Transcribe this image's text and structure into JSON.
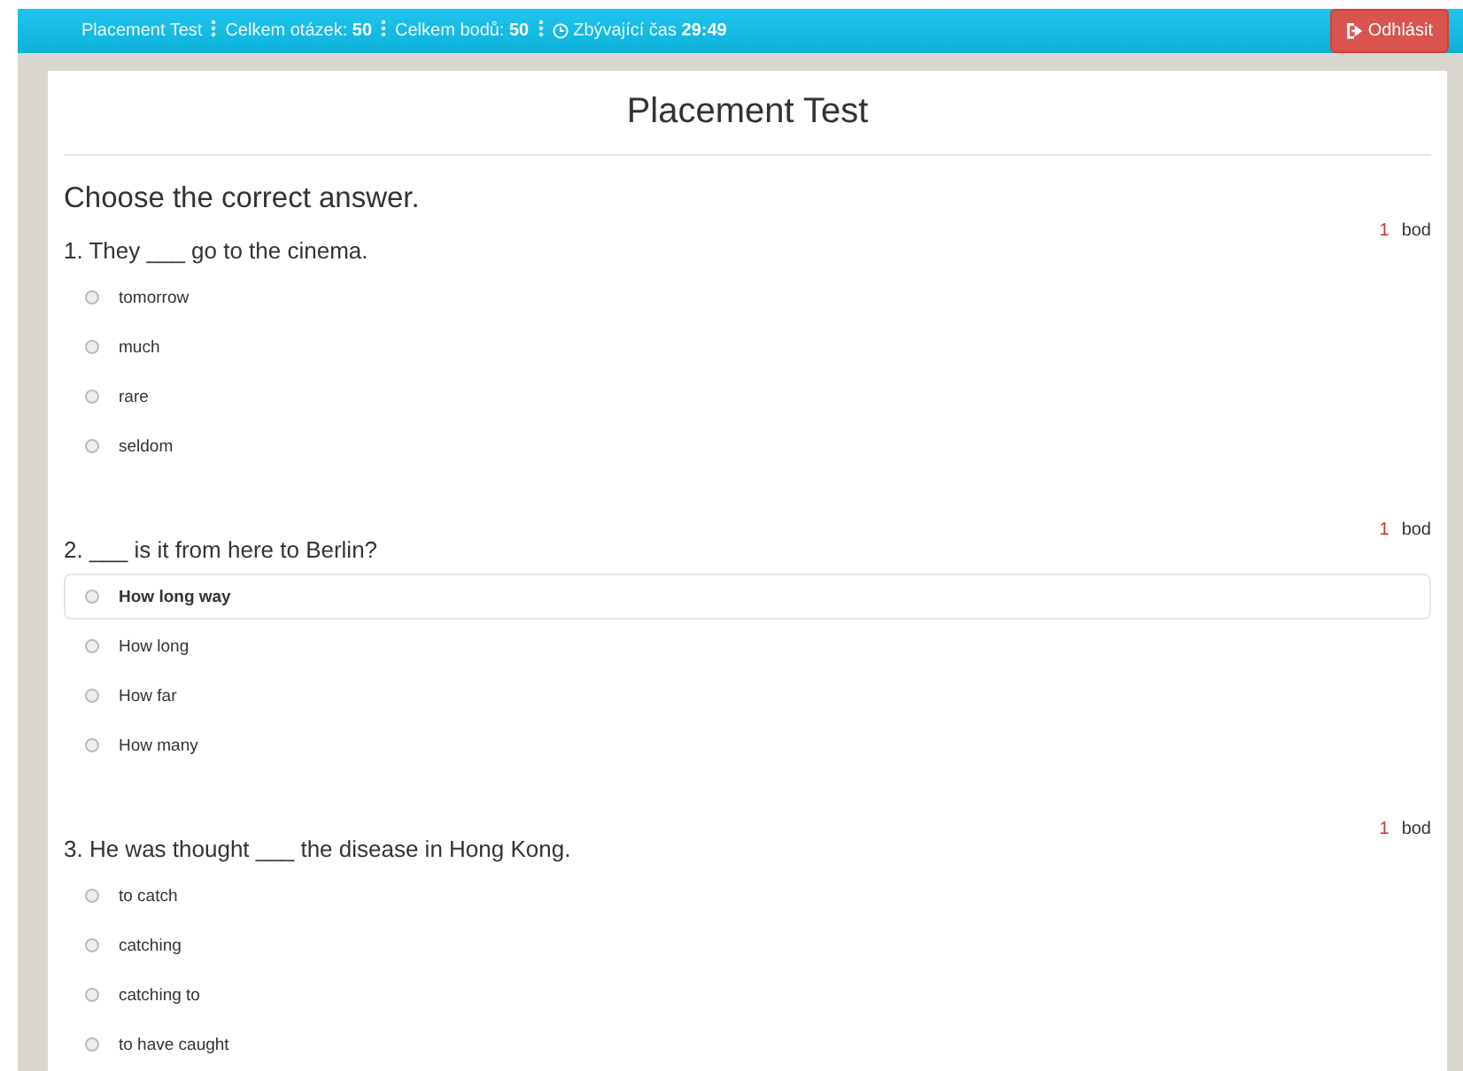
{
  "navbar": {
    "items": [
      {
        "kind": "text",
        "text": "Placement Test"
      },
      {
        "kind": "text",
        "text": "Celkem otázek: **50**"
      },
      {
        "kind": "text",
        "text": "Celkem bodů: **50**"
      },
      {
        "kind": "timer",
        "text": "Zbývající čas **29:49**"
      }
    ],
    "logout_button": "Odhlásit"
  },
  "title": "Placement Test",
  "instruction": "Choose the correct answer.",
  "questions": [
    {
      "text": "1. They ___ go to the cinema.",
      "points": "1",
      "points_unit": "bod",
      "options": [
        {
          "label": "tomorrow",
          "selected": false,
          "hovered": false
        },
        {
          "label": "much",
          "selected": false,
          "hovered": false
        },
        {
          "label": "rare",
          "selected": false,
          "hovered": false
        },
        {
          "label": "seldom",
          "selected": false,
          "hovered": false
        }
      ]
    },
    {
      "text": "2. ___ is it from here to Berlin?",
      "points": "1",
      "points_unit": "bod",
      "options": [
        {
          "label": "How long way",
          "selected": false,
          "hovered": true
        },
        {
          "label": "How long",
          "selected": false,
          "hovered": false
        },
        {
          "label": "How far",
          "selected": false,
          "hovered": false
        },
        {
          "label": "How many",
          "selected": false,
          "hovered": false
        }
      ]
    },
    {
      "text": "3. He was thought ___ the disease in Hong Kong.",
      "points": "1",
      "points_unit": "bod",
      "options": [
        {
          "label": "to catch",
          "selected": false,
          "hovered": false
        },
        {
          "label": "catching",
          "selected": false,
          "hovered": false
        },
        {
          "label": "catching to",
          "selected": false,
          "hovered": false
        },
        {
          "label": "to have caught",
          "selected": false,
          "hovered": false
        }
      ]
    }
  ]
}
